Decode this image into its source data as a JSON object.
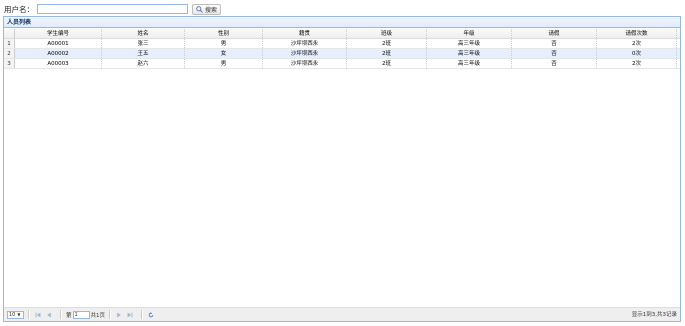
{
  "search": {
    "label": "用户名：",
    "value": "",
    "placeholder": "",
    "button_label": "搜索"
  },
  "panel": {
    "title": "人员列表"
  },
  "table": {
    "columns": [
      "学生编号",
      "姓名",
      "性别",
      "籍贯",
      "班级",
      "年级",
      "请假",
      "请假次数"
    ],
    "rows": [
      {
        "num": "1",
        "cells": [
          "A00001",
          "张三",
          "男",
          "沙坪坝西永",
          "2班",
          "高三年级",
          "否",
          "2次"
        ]
      },
      {
        "num": "2",
        "cells": [
          "A00002",
          "王五",
          "女",
          "沙坪坝西永",
          "2班",
          "高三年级",
          "否",
          "0次"
        ]
      },
      {
        "num": "3",
        "cells": [
          "A00003",
          "赵六",
          "男",
          "沙坪坝西永",
          "2班",
          "高三年级",
          "否",
          "2次"
        ]
      }
    ]
  },
  "pager": {
    "page_size": "10",
    "page_prefix": "第",
    "current_page": "1",
    "page_suffix": "共1页",
    "info": "显示1到3,共3记录"
  },
  "colors": {
    "accent_border": "#95b8e7",
    "selected_row": "#e6efff",
    "header_bg": "#e0ecff"
  }
}
